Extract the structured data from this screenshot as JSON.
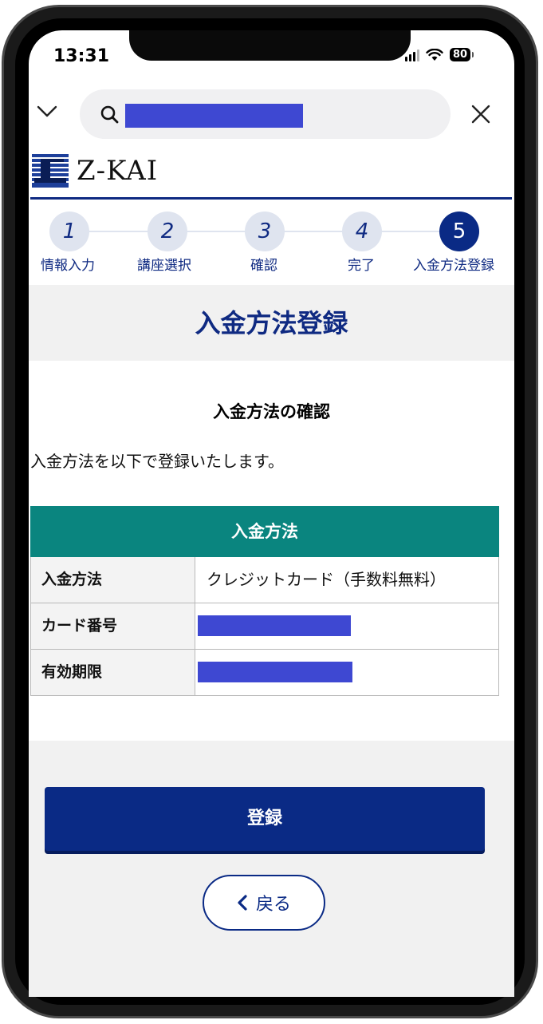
{
  "status": {
    "time": "13:31",
    "battery": "80"
  },
  "browser": {
    "search_value_redacted": true
  },
  "brand": {
    "logo_text": "Z-KAI"
  },
  "steps": [
    {
      "number": "1",
      "label": "情報入力",
      "active": false
    },
    {
      "number": "2",
      "label": "講座選択",
      "active": false
    },
    {
      "number": "3",
      "label": "確認",
      "active": false
    },
    {
      "number": "4",
      "label": "完了",
      "active": false
    },
    {
      "number": "5",
      "label": "入金方法登録",
      "active": true
    }
  ],
  "page": {
    "title": "入金方法登録",
    "subtitle": "入金方法の確認",
    "description": "入金方法を以下で登録いたします。"
  },
  "table": {
    "header": "入金方法",
    "rows": [
      {
        "label": "入金方法",
        "value": "クレジットカード（手数料無料）"
      },
      {
        "label": "カード番号",
        "value": ""
      },
      {
        "label": "有効期限",
        "value": ""
      }
    ]
  },
  "actions": {
    "register_label": "登録",
    "back_label": "戻る"
  },
  "colors": {
    "brand_navy": "#0a2a85",
    "table_header": "#0a857f",
    "redaction": "#3e48d2"
  }
}
